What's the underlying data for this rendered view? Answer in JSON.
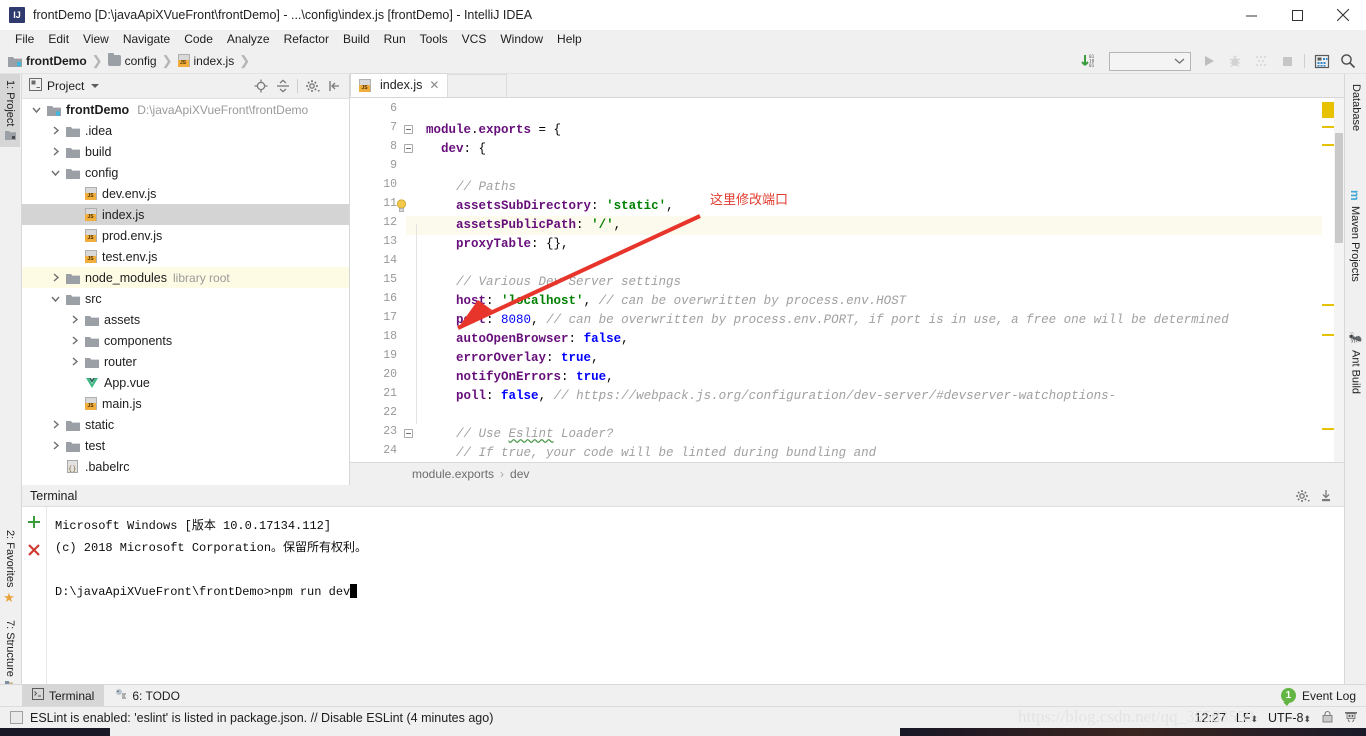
{
  "window": {
    "title": "frontDemo [D:\\javaApiXVueFront\\frontDemo] - ...\\config\\index.js [frontDemo] - IntelliJ IDEA",
    "app_icon": "IJ",
    "minimize": "minimize-icon",
    "maximize": "maximize-icon",
    "close": "close-icon"
  },
  "menubar": {
    "items": [
      "File",
      "Edit",
      "View",
      "Navigate",
      "Code",
      "Analyze",
      "Refactor",
      "Build",
      "Run",
      "Tools",
      "VCS",
      "Window",
      "Help"
    ]
  },
  "breadcrumb": {
    "items": [
      {
        "label": "frontDemo",
        "icon": "module-icon"
      },
      {
        "label": "config",
        "icon": "folder-icon"
      },
      {
        "label": "index.js",
        "icon": "js-file-icon"
      }
    ]
  },
  "toolbar_right": {
    "run_config_value": "",
    "buttons": [
      "updates-icon",
      "run-icon",
      "debug-icon",
      "coverage-icon",
      "stop-icon",
      "database-icon",
      "search-icon"
    ]
  },
  "left_tool_strip": [
    {
      "label": "1: Project",
      "active": true
    },
    {
      "label": "2: Favorites",
      "active": false
    },
    {
      "label": "7: Structure",
      "active": false
    }
  ],
  "right_tool_strip": [
    {
      "label": "Database"
    },
    {
      "label": "Maven Projects"
    },
    {
      "label": "Ant Build"
    }
  ],
  "project_panel": {
    "title": "Project",
    "header_icons": [
      "locate-icon",
      "collapse-all-icon",
      "settings-icon",
      "hide-icon"
    ],
    "tree": [
      {
        "indent": 0,
        "arrow": "down",
        "icon": "module-icon",
        "name": "frontDemo",
        "bold": true,
        "sub": "D:\\javaApiXVueFront\\frontDemo"
      },
      {
        "indent": 1,
        "arrow": "right",
        "icon": "folder-icon",
        "name": ".idea"
      },
      {
        "indent": 1,
        "arrow": "right",
        "icon": "folder-icon",
        "name": "build"
      },
      {
        "indent": 1,
        "arrow": "down",
        "icon": "folder-icon",
        "name": "config"
      },
      {
        "indent": 2,
        "arrow": "none",
        "icon": "js-file-icon",
        "name": "dev.env.js"
      },
      {
        "indent": 2,
        "arrow": "none",
        "icon": "js-file-icon",
        "name": "index.js",
        "selected": true
      },
      {
        "indent": 2,
        "arrow": "none",
        "icon": "js-file-icon",
        "name": "prod.env.js"
      },
      {
        "indent": 2,
        "arrow": "none",
        "icon": "js-file-icon",
        "name": "test.env.js"
      },
      {
        "indent": 1,
        "arrow": "right",
        "icon": "folder-icon",
        "name": "node_modules",
        "sub2": "library root",
        "library": true
      },
      {
        "indent": 1,
        "arrow": "down",
        "icon": "folder-icon",
        "name": "src"
      },
      {
        "indent": 2,
        "arrow": "right",
        "icon": "folder-icon",
        "name": "assets"
      },
      {
        "indent": 2,
        "arrow": "right",
        "icon": "folder-icon",
        "name": "components"
      },
      {
        "indent": 2,
        "arrow": "right",
        "icon": "folder-icon",
        "name": "router"
      },
      {
        "indent": 2,
        "arrow": "none",
        "icon": "vue-file-icon",
        "name": "App.vue"
      },
      {
        "indent": 2,
        "arrow": "none",
        "icon": "js-file-icon",
        "name": "main.js"
      },
      {
        "indent": 1,
        "arrow": "right",
        "icon": "folder-icon",
        "name": "static"
      },
      {
        "indent": 1,
        "arrow": "right",
        "icon": "folder-icon",
        "name": "test"
      },
      {
        "indent": 1,
        "arrow": "none",
        "icon": "babelrc-icon",
        "name": ".babelrc"
      }
    ]
  },
  "editor": {
    "tabs": [
      {
        "label": "index.js",
        "icon": "js-file-icon",
        "close": "close-icon",
        "active": true
      }
    ],
    "first_line_number": 6,
    "highlighted_line": 12,
    "lines": [
      {
        "n": 6,
        "tokens": []
      },
      {
        "n": 7,
        "fold": true,
        "tokens": [
          {
            "t": "module",
            "c": "prop"
          },
          {
            "t": ".",
            "c": "pln"
          },
          {
            "t": "exports",
            "c": "prop"
          },
          {
            "t": " = {",
            "c": "pln"
          }
        ]
      },
      {
        "n": 8,
        "fold": true,
        "tokens": [
          {
            "t": "  ",
            "c": "pln"
          },
          {
            "t": "dev",
            "c": "prop"
          },
          {
            "t": ": {",
            "c": "pln"
          }
        ]
      },
      {
        "n": 9,
        "tokens": []
      },
      {
        "n": 10,
        "tokens": [
          {
            "t": "    // Paths",
            "c": "cmt"
          }
        ]
      },
      {
        "n": 11,
        "bulb": true,
        "tokens": [
          {
            "t": "    ",
            "c": "pln"
          },
          {
            "t": "assetsSubDirectory",
            "c": "prop"
          },
          {
            "t": ": ",
            "c": "pln"
          },
          {
            "t": "'static'",
            "c": "str"
          },
          {
            "t": ",",
            "c": "pln"
          }
        ]
      },
      {
        "n": 12,
        "tokens": [
          {
            "t": "    ",
            "c": "pln"
          },
          {
            "t": "assetsPublicPath",
            "c": "prop"
          },
          {
            "t": ": ",
            "c": "pln"
          },
          {
            "t": "'/'",
            "c": "str"
          },
          {
            "t": ",",
            "c": "pln"
          }
        ]
      },
      {
        "n": 13,
        "tokens": [
          {
            "t": "    ",
            "c": "pln"
          },
          {
            "t": "proxyTable",
            "c": "prop"
          },
          {
            "t": ": {},",
            "c": "pln"
          }
        ]
      },
      {
        "n": 14,
        "tokens": []
      },
      {
        "n": 15,
        "tokens": [
          {
            "t": "    // Various Dev Server settings",
            "c": "cmt"
          }
        ]
      },
      {
        "n": 16,
        "tokens": [
          {
            "t": "    ",
            "c": "pln"
          },
          {
            "t": "host",
            "c": "prop"
          },
          {
            "t": ": ",
            "c": "pln"
          },
          {
            "t": "'localhost'",
            "c": "str"
          },
          {
            "t": ", ",
            "c": "pln"
          },
          {
            "t": "// can be overwritten by process.env.HOST",
            "c": "cmt"
          }
        ]
      },
      {
        "n": 17,
        "tokens": [
          {
            "t": "    ",
            "c": "pln"
          },
          {
            "t": "port",
            "c": "prop"
          },
          {
            "t": ": ",
            "c": "pln"
          },
          {
            "t": "8080",
            "c": "num"
          },
          {
            "t": ", ",
            "c": "pln"
          },
          {
            "t": "// can be overwritten by process.env.PORT, if port is in use, a free one will be determined",
            "c": "cmt"
          }
        ]
      },
      {
        "n": 18,
        "tokens": [
          {
            "t": "    ",
            "c": "pln"
          },
          {
            "t": "autoOpenBrowser",
            "c": "prop"
          },
          {
            "t": ": ",
            "c": "pln"
          },
          {
            "t": "false",
            "c": "bool"
          },
          {
            "t": ",",
            "c": "pln"
          }
        ]
      },
      {
        "n": 19,
        "tokens": [
          {
            "t": "    ",
            "c": "pln"
          },
          {
            "t": "errorOverlay",
            "c": "prop"
          },
          {
            "t": ": ",
            "c": "pln"
          },
          {
            "t": "true",
            "c": "bool"
          },
          {
            "t": ",",
            "c": "pln"
          }
        ]
      },
      {
        "n": 20,
        "tokens": [
          {
            "t": "    ",
            "c": "pln"
          },
          {
            "t": "notifyOnErrors",
            "c": "prop"
          },
          {
            "t": ": ",
            "c": "pln"
          },
          {
            "t": "true",
            "c": "bool"
          },
          {
            "t": ",",
            "c": "pln"
          }
        ]
      },
      {
        "n": 21,
        "tokens": [
          {
            "t": "    ",
            "c": "pln"
          },
          {
            "t": "poll",
            "c": "prop"
          },
          {
            "t": ": ",
            "c": "pln"
          },
          {
            "t": "false",
            "c": "bool"
          },
          {
            "t": ", ",
            "c": "pln"
          },
          {
            "t": "// https://webpack.js.org/configuration/dev-server/#devserver-watchoptions-",
            "c": "cmt"
          }
        ]
      },
      {
        "n": 22,
        "tokens": []
      },
      {
        "n": 23,
        "fold": true,
        "tokens": [
          {
            "t": "    // Use ",
            "c": "cmt"
          },
          {
            "t": "Eslint",
            "c": "cmt-squig"
          },
          {
            "t": " Loader?",
            "c": "cmt"
          }
        ]
      },
      {
        "n": 24,
        "tokens": [
          {
            "t": "    // If true, your code will be linted during bundling and",
            "c": "cmt"
          }
        ]
      }
    ],
    "annotation": {
      "text": "这里修改端口",
      "color": "#e23b2e",
      "arrow": "red-arrow"
    },
    "status_crumb": {
      "parts": [
        "module.exports",
        "dev"
      ],
      "separator": "›"
    }
  },
  "terminal": {
    "title": "Terminal",
    "side_buttons": [
      "add-icon",
      "close-icon"
    ],
    "header_icons": [
      "settings-icon",
      "hide-icon"
    ],
    "lines": [
      "Microsoft Windows [版本 10.0.17134.112]",
      "(c) 2018 Microsoft Corporation。保留所有权利。",
      "",
      "D:\\javaApiXVueFront\\frontDemo>npm run dev"
    ]
  },
  "bottom_tabs": [
    {
      "label": "Terminal",
      "icon": "terminal-icon",
      "active": true
    },
    {
      "label": "6: TODO",
      "icon": "todo-icon",
      "active": false
    }
  ],
  "event_log": {
    "label": "Event Log",
    "count": "1",
    "color": "#62b543"
  },
  "statusbar": {
    "message": "ESLint is enabled: 'eslint' is listed in package.json. // Disable ESLint (4 minutes ago)",
    "time": "12:27",
    "line_separator": "LF",
    "encoding": "UTF-8",
    "lock_icon": "lock-icon",
    "inspection_icon": "hector-icon"
  },
  "watermark": {
    "text": "https://blog.csdn.net/qq_35583559"
  }
}
